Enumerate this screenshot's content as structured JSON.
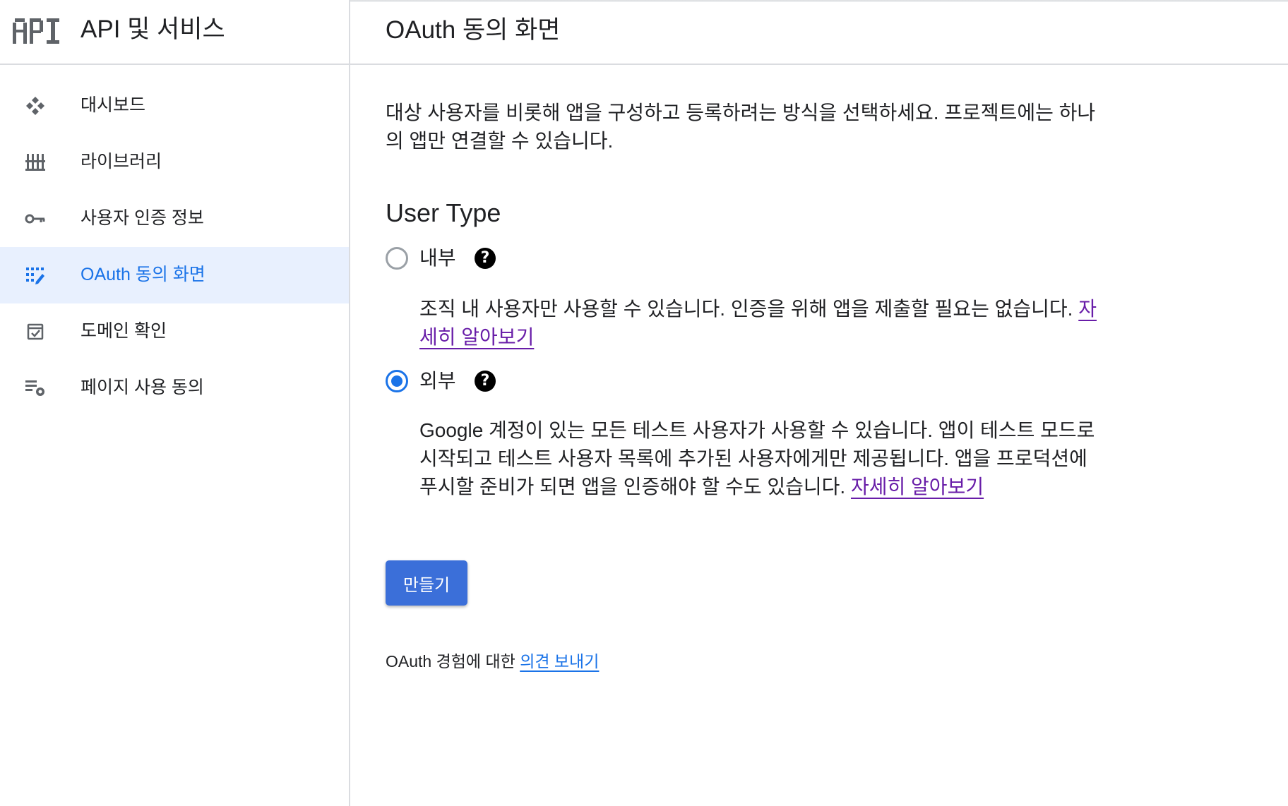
{
  "app": {
    "logo_text": "API",
    "product_title": "API 및 서비스"
  },
  "sidebar": {
    "items": [
      {
        "label": "대시보드",
        "icon": "dashboard-icon",
        "active": false
      },
      {
        "label": "라이브러리",
        "icon": "library-icon",
        "active": false
      },
      {
        "label": "사용자 인증 정보",
        "icon": "key-icon",
        "active": false
      },
      {
        "label": "OAuth 동의 화면",
        "icon": "oauth-consent-icon",
        "active": true
      },
      {
        "label": "도메인 확인",
        "icon": "domain-verification-icon",
        "active": false
      },
      {
        "label": "페이지 사용 동의",
        "icon": "page-usage-settings-icon",
        "active": false
      }
    ]
  },
  "header": {
    "title": "OAuth 동의 화면"
  },
  "main": {
    "intro": "대상 사용자를 비롯해 앱을 구성하고 등록하려는 방식을 선택하세요. 프로젝트에는 하나의 앱만 연결할 수 있습니다.",
    "section_title": "User Type",
    "options": [
      {
        "label": "내부",
        "checked": false,
        "description": "조직 내 사용자만 사용할 수 있습니다. 인증을 위해 앱을 제출할 필요는 없습니다. ",
        "link": "자세히 알아보기"
      },
      {
        "label": "외부",
        "checked": true,
        "description": "Google 계정이 있는 모든 테스트 사용자가 사용할 수 있습니다. 앱이 테스트 모드로 시작되고 테스트 사용자 목록에 추가된 사용자에게만 제공됩니다. 앱을 프로덕션에 푸시할 준비가 되면 앱을 인증해야 할 수도 있습니다. ",
        "link": "자세히 알아보기"
      }
    ],
    "help_glyph": "?",
    "create_button": "만들기",
    "feedback_text": "OAuth 경험에 대한 ",
    "feedback_link": "의견 보내기"
  },
  "colors": {
    "accent": "#1a73e8",
    "active_bg": "#e8f0fe",
    "button": "#3b6fd9",
    "link_visited": "#681da8",
    "divider": "#dadce0"
  }
}
